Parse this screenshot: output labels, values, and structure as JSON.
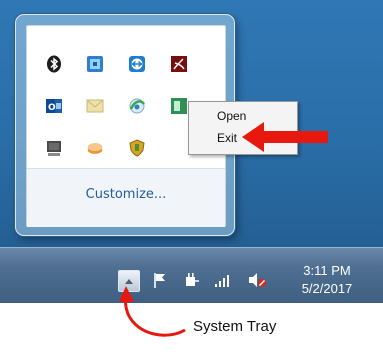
{
  "flyout": {
    "icons": [
      {
        "name": "bluetooth-icon"
      },
      {
        "name": "network-app-icon"
      },
      {
        "name": "teamviewer-icon"
      },
      {
        "name": "adobe-reader-icon"
      },
      {
        "name": "outlook-icon"
      },
      {
        "name": "mail-icon"
      },
      {
        "name": "browser-icon"
      },
      {
        "name": "green-app-icon"
      },
      {
        "name": "display-icon"
      },
      {
        "name": "storage-icon"
      },
      {
        "name": "security-shield-icon"
      }
    ],
    "customize_label": "Customize..."
  },
  "context_menu": {
    "items": [
      {
        "label": "Open"
      },
      {
        "label": "Exit"
      }
    ]
  },
  "taskbar": {
    "tray_icons": [
      "show-hidden-icons-button",
      "action-center-flag-icon",
      "power-icon",
      "signal-icon",
      "volume-muted-icon"
    ],
    "clock_time": "3:11 PM",
    "clock_date": "5/2/2017"
  },
  "annotations": {
    "caption": "System Tray",
    "arrow_color": "#e8180f"
  }
}
